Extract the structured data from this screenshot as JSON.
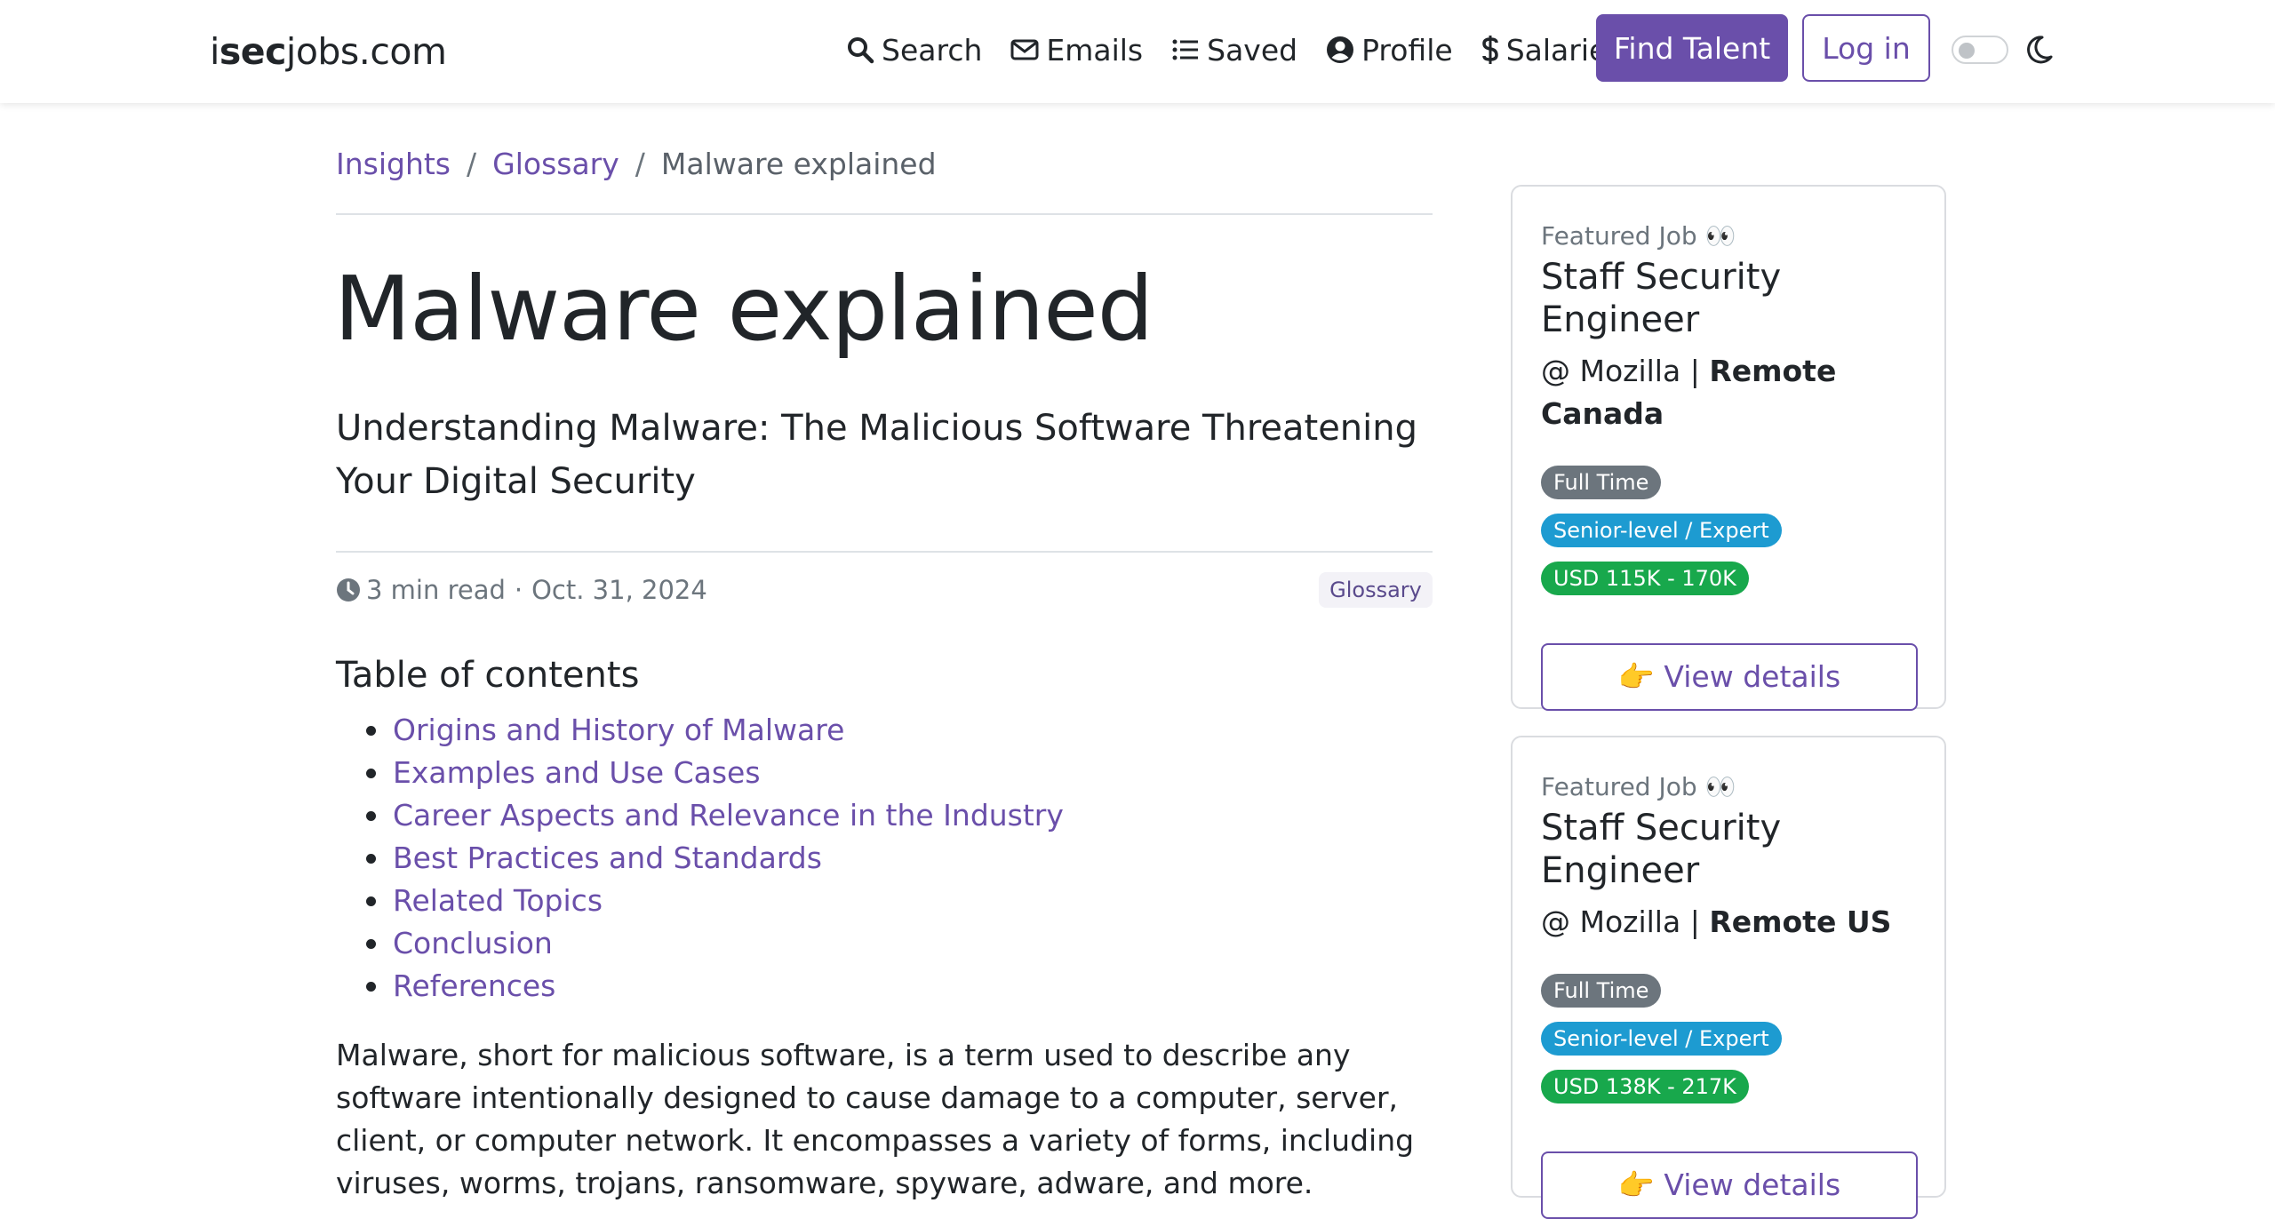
{
  "navbar": {
    "brand_prefix": "i",
    "brand_bold": "sec",
    "brand_suffix": "jobs.com",
    "links": {
      "search": "Search",
      "emails": "Emails",
      "saved": "Saved",
      "profile": "Profile",
      "salaries": "Salaries"
    },
    "find_talent": "Find Talent",
    "login": "Log in"
  },
  "breadcrumb": {
    "insights": "Insights",
    "glossary": "Glossary",
    "current": "Malware explained",
    "separator": "/"
  },
  "article": {
    "title": "Malware explained",
    "subtitle": "Understanding Malware: The Malicious Software Threatening Your Digital Security",
    "read_time": "3 min read",
    "date": "Oct. 31, 2024",
    "meta_sep": "·",
    "category": "Glossary",
    "toc_title": "Table of contents",
    "toc": [
      "Origins and History of Malware",
      "Examples and Use Cases",
      "Career Aspects and Relevance in the Industry",
      "Best Practices and Standards",
      "Related Topics",
      "Conclusion",
      "References"
    ],
    "intro": "Malware, short for malicious software, is a term used to describe any software intentionally designed to cause damage to a computer, server, client, or computer network. It encompasses a variety of forms, including viruses, worms, trojans, ransomware, spyware, adware, and more."
  },
  "sidebar": {
    "cards": [
      {
        "featured": "Featured Job 👀",
        "title": "Staff Security Engineer",
        "company": "@ Mozilla",
        "sep": "|",
        "location": "Remote Canada",
        "badges": [
          "Full Time",
          "Senior-level / Expert",
          "USD 115K - 170K"
        ],
        "button": "👉 View details"
      },
      {
        "featured": "Featured Job 👀",
        "title": "Staff Security Engineer",
        "company": "@ Mozilla",
        "sep": "|",
        "location": "Remote US",
        "badges": [
          "Full Time",
          "Senior-level / Expert",
          "USD 138K - 217K"
        ],
        "button": "👉 View details"
      }
    ]
  },
  "colors": {
    "accent": "#6a4faa",
    "badge_grey": "#6c757d",
    "badge_blue": "#1d9bd1",
    "badge_green": "#18a84c"
  }
}
